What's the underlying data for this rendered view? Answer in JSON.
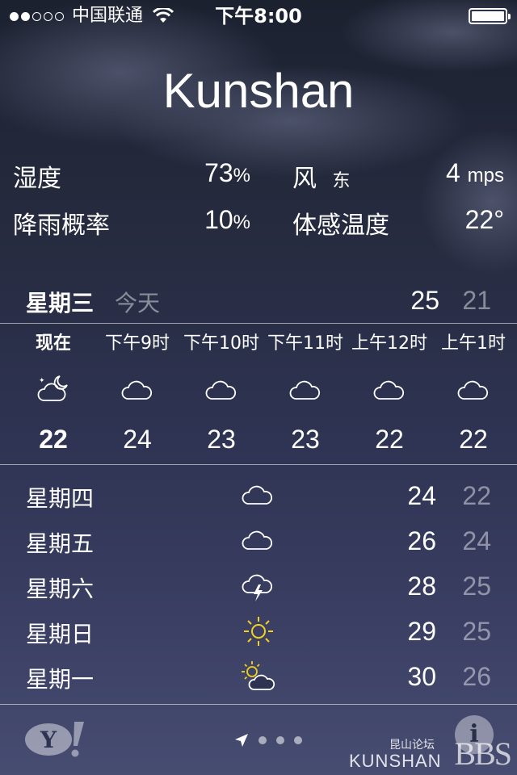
{
  "status_bar": {
    "signal_dots": [
      true,
      true,
      false,
      false,
      false
    ],
    "carrier": "中国联通",
    "time": "下午8:00",
    "battery_level": 1.0
  },
  "city": "Kunshan",
  "stats": {
    "humidity": {
      "label": "湿度",
      "value": "73",
      "unit": "%"
    },
    "wind": {
      "label": "风",
      "direction": "东",
      "value": "4",
      "unit": "mps"
    },
    "rain": {
      "label": "降雨概率",
      "value": "10",
      "unit": "%"
    },
    "feels_like": {
      "label": "体感温度",
      "value": "22°"
    }
  },
  "today": {
    "day": "星期三",
    "label": "今天",
    "high": "25",
    "low": "21"
  },
  "hourly": [
    {
      "label": "现在",
      "icon": "night-partly-cloudy-icon",
      "temp": "22",
      "now": true
    },
    {
      "label": "下午9时",
      "icon": "cloud-icon",
      "temp": "24"
    },
    {
      "label": "下午10时",
      "icon": "cloud-icon",
      "temp": "23"
    },
    {
      "label": "下午11时",
      "icon": "cloud-icon",
      "temp": "23"
    },
    {
      "label": "上午12时",
      "icon": "cloud-icon",
      "temp": "22"
    },
    {
      "label": "上午1时",
      "icon": "cloud-icon",
      "temp": "22"
    }
  ],
  "daily": [
    {
      "day": "星期四",
      "icon": "cloud-icon",
      "high": "24",
      "low": "22"
    },
    {
      "day": "星期五",
      "icon": "cloud-icon",
      "high": "26",
      "low": "24"
    },
    {
      "day": "星期六",
      "icon": "thunderstorm-icon",
      "high": "28",
      "low": "25"
    },
    {
      "day": "星期日",
      "icon": "sun-icon",
      "high": "29",
      "low": "25"
    },
    {
      "day": "星期一",
      "icon": "partly-sunny-icon",
      "high": "30",
      "low": "26"
    }
  ],
  "bottom": {
    "yahoo_logo": "Y!",
    "page_dots": 3,
    "info_icon": "i",
    "watermark_cn": "昆山论坛",
    "watermark_name": "KUNSHAN",
    "watermark_bbs": "BBS"
  },
  "colors": {
    "sun": "#f2d21b",
    "text": "#ffffff",
    "muted": "rgba(255,255,255,0.45)"
  }
}
